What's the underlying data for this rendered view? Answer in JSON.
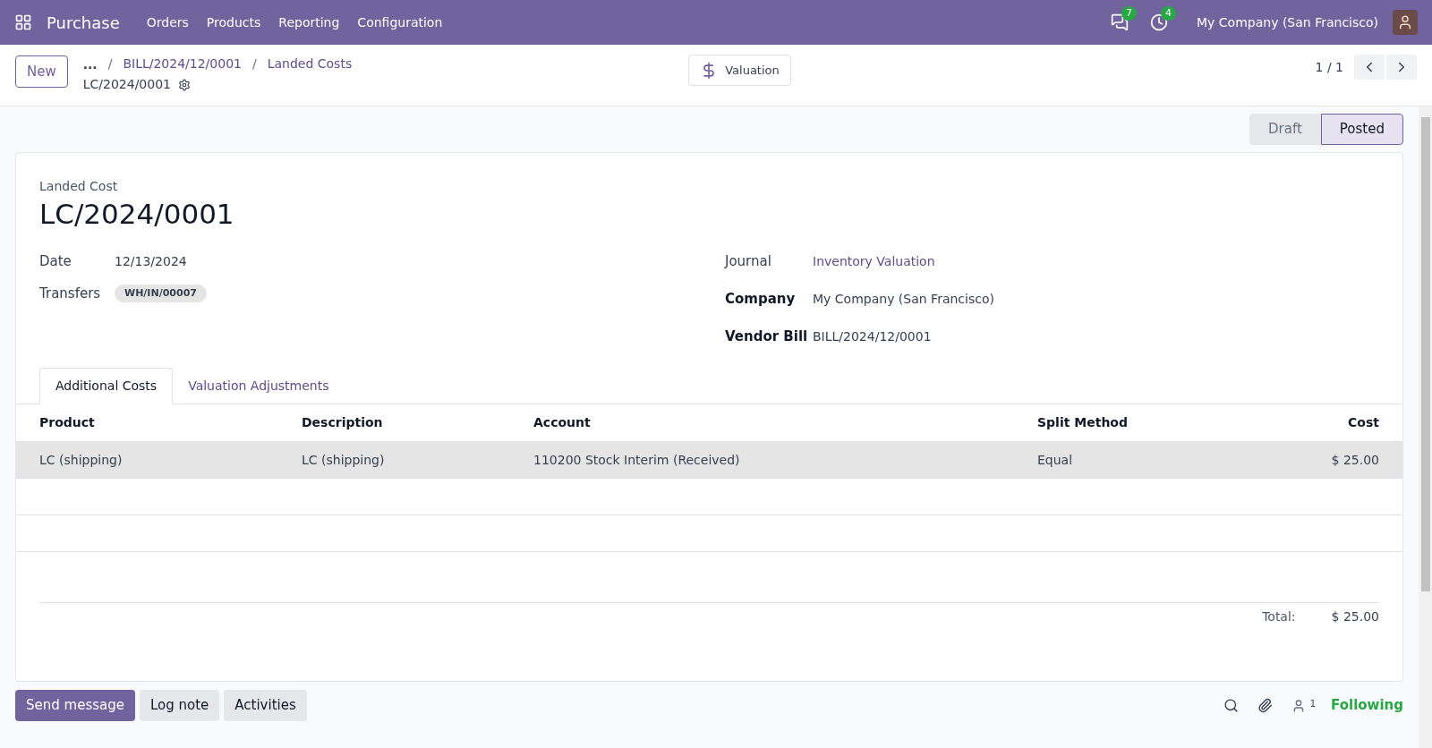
{
  "navbar": {
    "app_name": "Purchase",
    "menu": [
      "Orders",
      "Products",
      "Reporting",
      "Configuration"
    ],
    "messages_count": "7",
    "activities_count": "4",
    "company": "My Company (San Francisco)"
  },
  "control_panel": {
    "new_button": "New",
    "breadcrumb_more": "...",
    "breadcrumbs": [
      "BILL/2024/12/0001",
      "Landed Costs"
    ],
    "breadcrumb_separator": "/",
    "record_name": "LC/2024/0001",
    "smart_button": "Valuation",
    "pager": "1 / 1"
  },
  "status_bar": [
    {
      "label": "Draft",
      "selected": false
    },
    {
      "label": "Posted",
      "selected": true
    }
  ],
  "form": {
    "title_label": "Landed Cost",
    "name": "LC/2024/0001",
    "left_fields": [
      {
        "label": "Date",
        "value": "12/13/2024",
        "kind": "text"
      },
      {
        "label": "Transfers",
        "value": "WH/IN/00007",
        "kind": "tag"
      }
    ],
    "right_fields": [
      {
        "label": "Journal",
        "value": "Inventory Valuation",
        "kind": "link"
      },
      {
        "label": "Company",
        "value": "My Company (San Francisco)",
        "kind": "text"
      },
      {
        "label": "Vendor Bill",
        "value": "BILL/2024/12/0001",
        "kind": "text"
      }
    ],
    "tabs": [
      {
        "label": "Additional Costs",
        "selected": true
      },
      {
        "label": "Valuation Adjustments",
        "selected": false
      }
    ],
    "table": {
      "columns": [
        "Product",
        "Description",
        "Account",
        "Split Method",
        "Cost"
      ],
      "rows": [
        [
          "LC (shipping)",
          "LC (shipping)",
          "110200 Stock Interim (Received)",
          "Equal",
          "$ 25.00"
        ]
      ]
    },
    "total_label": "Total:",
    "total_value": "$ 25.00"
  },
  "chatter": {
    "buttons": [
      "Send message",
      "Log note",
      "Activities"
    ],
    "followers_count": "1",
    "following": "Following"
  }
}
